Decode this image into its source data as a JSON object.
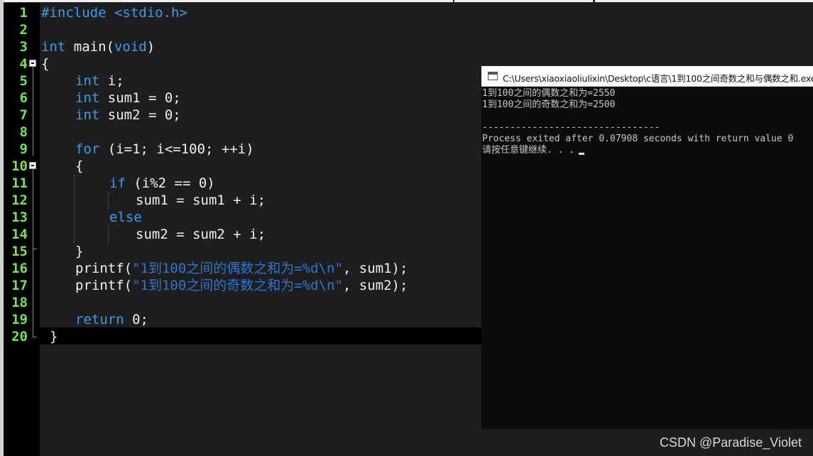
{
  "editor": {
    "line_numbers": [
      "1",
      "2",
      "3",
      "4",
      "5",
      "6",
      "7",
      "8",
      "9",
      "10",
      "11",
      "12",
      "13",
      "14",
      "15",
      "16",
      "17",
      "18",
      "19",
      "20"
    ],
    "code": {
      "l1": "#include <stdio.h>",
      "l3_type": "int",
      "l3_rest": " main(",
      "l3_void": "void",
      "l3_close": ")",
      "l4": "{",
      "l5_type": "int",
      "l5_rest": " i;",
      "l6_type": "int",
      "l6_rest": " sum1 = 0;",
      "l7_type": "int",
      "l7_rest": " sum2 = 0;",
      "l9_kw": "for",
      "l9_rest": " (i=1; i<=100; ++i)",
      "l10": "{",
      "l11_kw": "if",
      "l11_rest": " (i%2 == 0)",
      "l12": "sum1 = sum1 + i;",
      "l13_kw": "else",
      "l14": "sum2 = sum2 + i;",
      "l15": "}",
      "l16_fn": "printf(",
      "l16_str": "\"1到100之间的偶数之和为=%d\\n\"",
      "l16_rest": ", sum1);",
      "l17_fn": "printf(",
      "l17_str": "\"1到100之间的奇数之和为=%d\\n\"",
      "l17_rest": ", sum2);",
      "l19_kw": "return",
      "l19_rest": " 0;",
      "l20": "}"
    }
  },
  "console": {
    "title": "C:\\Users\\xiaoxiaoliulixin\\Desktop\\c语言\\1到100之间奇数之和与偶数之和.exe",
    "lines": [
      "1到100之间的偶数之和为=2550",
      "1到100之间的奇数之和为=2500",
      "",
      "--------------------------------",
      "Process exited after 0.07908 seconds with return value 0",
      "请按任意键继续. . ."
    ],
    "icon": "console-window-icon"
  },
  "watermark": "CSDN @Paradise_Violet"
}
